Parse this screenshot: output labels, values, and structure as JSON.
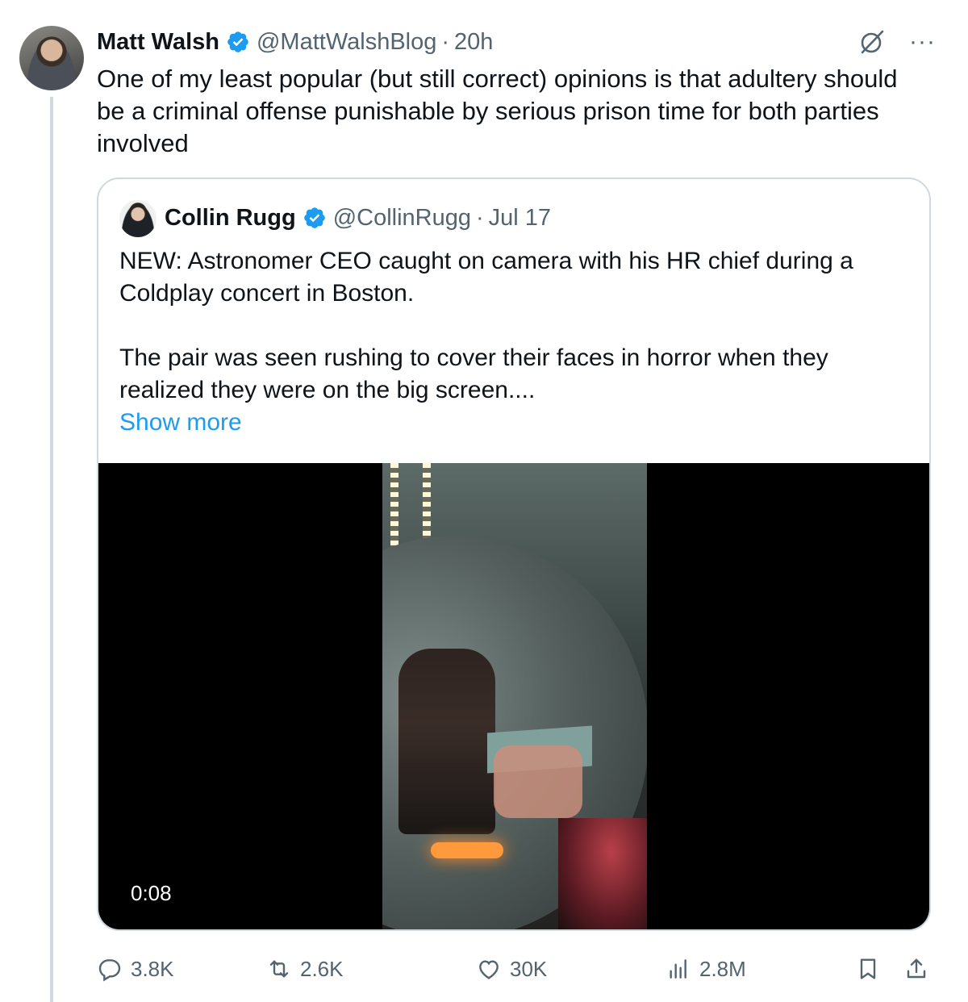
{
  "tweet": {
    "author_name": "Matt Walsh",
    "handle": "@MattWalshBlog",
    "separator": "·",
    "time": "20h",
    "text": "One of my least popular (but still correct) opinions is that adultery should be a criminal offense punishable by serious prison time for both parties involved",
    "more_glyph": "···"
  },
  "quote": {
    "author_name": "Collin Rugg",
    "handle": "@CollinRugg",
    "separator": "·",
    "time": "Jul 17",
    "text": "NEW: Astronomer CEO caught on camera with his HR chief during a Coldplay concert in Boston.\n\nThe pair was seen rushing to cover their faces in horror when they realized they were on the big screen....",
    "show_more": "Show more",
    "video_time": "0:08"
  },
  "actions": {
    "replies": "3.8K",
    "reposts": "2.6K",
    "likes": "30K",
    "views": "2.8M"
  },
  "colors": {
    "verified": "#1d9bf0",
    "link": "#1d9bf0",
    "muted": "#536471",
    "border": "#cfd9de"
  },
  "icons": [
    "verified-badge-icon",
    "grok-icon",
    "more-icon",
    "reply-icon",
    "repost-icon",
    "like-icon",
    "views-icon",
    "bookmark-icon",
    "share-icon"
  ]
}
